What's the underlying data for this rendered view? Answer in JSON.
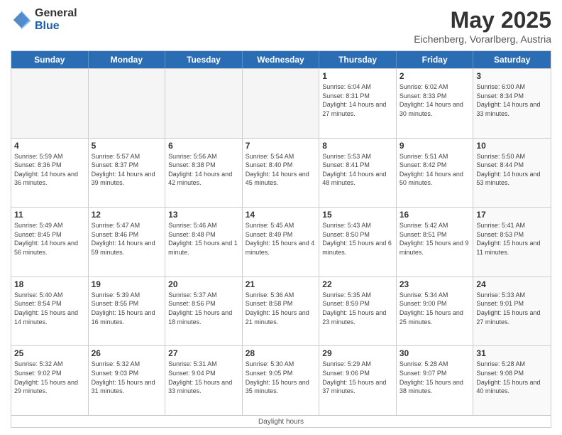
{
  "logo": {
    "general": "General",
    "blue": "Blue"
  },
  "title": "May 2025",
  "location": "Eichenberg, Vorarlberg, Austria",
  "days_of_week": [
    "Sunday",
    "Monday",
    "Tuesday",
    "Wednesday",
    "Thursday",
    "Friday",
    "Saturday"
  ],
  "footer": "Daylight hours",
  "weeks": [
    [
      {
        "day": "",
        "empty": true
      },
      {
        "day": "",
        "empty": true
      },
      {
        "day": "",
        "empty": true
      },
      {
        "day": "",
        "empty": true
      },
      {
        "day": "1",
        "sunrise": "Sunrise: 6:04 AM",
        "sunset": "Sunset: 8:31 PM",
        "daylight": "Daylight: 14 hours and 27 minutes."
      },
      {
        "day": "2",
        "sunrise": "Sunrise: 6:02 AM",
        "sunset": "Sunset: 8:33 PM",
        "daylight": "Daylight: 14 hours and 30 minutes."
      },
      {
        "day": "3",
        "sunrise": "Sunrise: 6:00 AM",
        "sunset": "Sunset: 8:34 PM",
        "daylight": "Daylight: 14 hours and 33 minutes.",
        "gray": true
      }
    ],
    [
      {
        "day": "4",
        "sunrise": "Sunrise: 5:59 AM",
        "sunset": "Sunset: 8:36 PM",
        "daylight": "Daylight: 14 hours and 36 minutes."
      },
      {
        "day": "5",
        "sunrise": "Sunrise: 5:57 AM",
        "sunset": "Sunset: 8:37 PM",
        "daylight": "Daylight: 14 hours and 39 minutes."
      },
      {
        "day": "6",
        "sunrise": "Sunrise: 5:56 AM",
        "sunset": "Sunset: 8:38 PM",
        "daylight": "Daylight: 14 hours and 42 minutes."
      },
      {
        "day": "7",
        "sunrise": "Sunrise: 5:54 AM",
        "sunset": "Sunset: 8:40 PM",
        "daylight": "Daylight: 14 hours and 45 minutes."
      },
      {
        "day": "8",
        "sunrise": "Sunrise: 5:53 AM",
        "sunset": "Sunset: 8:41 PM",
        "daylight": "Daylight: 14 hours and 48 minutes."
      },
      {
        "day": "9",
        "sunrise": "Sunrise: 5:51 AM",
        "sunset": "Sunset: 8:42 PM",
        "daylight": "Daylight: 14 hours and 50 minutes."
      },
      {
        "day": "10",
        "sunrise": "Sunrise: 5:50 AM",
        "sunset": "Sunset: 8:44 PM",
        "daylight": "Daylight: 14 hours and 53 minutes.",
        "gray": true
      }
    ],
    [
      {
        "day": "11",
        "sunrise": "Sunrise: 5:49 AM",
        "sunset": "Sunset: 8:45 PM",
        "daylight": "Daylight: 14 hours and 56 minutes."
      },
      {
        "day": "12",
        "sunrise": "Sunrise: 5:47 AM",
        "sunset": "Sunset: 8:46 PM",
        "daylight": "Daylight: 14 hours and 59 minutes."
      },
      {
        "day": "13",
        "sunrise": "Sunrise: 5:46 AM",
        "sunset": "Sunset: 8:48 PM",
        "daylight": "Daylight: 15 hours and 1 minute."
      },
      {
        "day": "14",
        "sunrise": "Sunrise: 5:45 AM",
        "sunset": "Sunset: 8:49 PM",
        "daylight": "Daylight: 15 hours and 4 minutes."
      },
      {
        "day": "15",
        "sunrise": "Sunrise: 5:43 AM",
        "sunset": "Sunset: 8:50 PM",
        "daylight": "Daylight: 15 hours and 6 minutes."
      },
      {
        "day": "16",
        "sunrise": "Sunrise: 5:42 AM",
        "sunset": "Sunset: 8:51 PM",
        "daylight": "Daylight: 15 hours and 9 minutes."
      },
      {
        "day": "17",
        "sunrise": "Sunrise: 5:41 AM",
        "sunset": "Sunset: 8:53 PM",
        "daylight": "Daylight: 15 hours and 11 minutes.",
        "gray": true
      }
    ],
    [
      {
        "day": "18",
        "sunrise": "Sunrise: 5:40 AM",
        "sunset": "Sunset: 8:54 PM",
        "daylight": "Daylight: 15 hours and 14 minutes."
      },
      {
        "day": "19",
        "sunrise": "Sunrise: 5:39 AM",
        "sunset": "Sunset: 8:55 PM",
        "daylight": "Daylight: 15 hours and 16 minutes."
      },
      {
        "day": "20",
        "sunrise": "Sunrise: 5:37 AM",
        "sunset": "Sunset: 8:56 PM",
        "daylight": "Daylight: 15 hours and 18 minutes."
      },
      {
        "day": "21",
        "sunrise": "Sunrise: 5:36 AM",
        "sunset": "Sunset: 8:58 PM",
        "daylight": "Daylight: 15 hours and 21 minutes."
      },
      {
        "day": "22",
        "sunrise": "Sunrise: 5:35 AM",
        "sunset": "Sunset: 8:59 PM",
        "daylight": "Daylight: 15 hours and 23 minutes."
      },
      {
        "day": "23",
        "sunrise": "Sunrise: 5:34 AM",
        "sunset": "Sunset: 9:00 PM",
        "daylight": "Daylight: 15 hours and 25 minutes."
      },
      {
        "day": "24",
        "sunrise": "Sunrise: 5:33 AM",
        "sunset": "Sunset: 9:01 PM",
        "daylight": "Daylight: 15 hours and 27 minutes.",
        "gray": true
      }
    ],
    [
      {
        "day": "25",
        "sunrise": "Sunrise: 5:32 AM",
        "sunset": "Sunset: 9:02 PM",
        "daylight": "Daylight: 15 hours and 29 minutes."
      },
      {
        "day": "26",
        "sunrise": "Sunrise: 5:32 AM",
        "sunset": "Sunset: 9:03 PM",
        "daylight": "Daylight: 15 hours and 31 minutes."
      },
      {
        "day": "27",
        "sunrise": "Sunrise: 5:31 AM",
        "sunset": "Sunset: 9:04 PM",
        "daylight": "Daylight: 15 hours and 33 minutes."
      },
      {
        "day": "28",
        "sunrise": "Sunrise: 5:30 AM",
        "sunset": "Sunset: 9:05 PM",
        "daylight": "Daylight: 15 hours and 35 minutes."
      },
      {
        "day": "29",
        "sunrise": "Sunrise: 5:29 AM",
        "sunset": "Sunset: 9:06 PM",
        "daylight": "Daylight: 15 hours and 37 minutes."
      },
      {
        "day": "30",
        "sunrise": "Sunrise: 5:28 AM",
        "sunset": "Sunset: 9:07 PM",
        "daylight": "Daylight: 15 hours and 38 minutes."
      },
      {
        "day": "31",
        "sunrise": "Sunrise: 5:28 AM",
        "sunset": "Sunset: 9:08 PM",
        "daylight": "Daylight: 15 hours and 40 minutes.",
        "gray": true
      }
    ]
  ]
}
